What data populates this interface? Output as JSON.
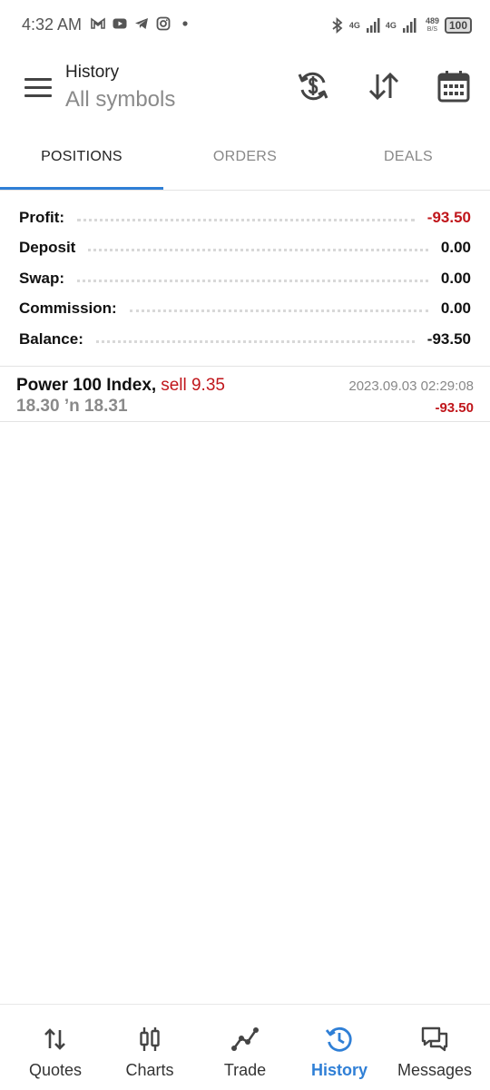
{
  "status_bar": {
    "time": "4:32 AM",
    "network_1": "4G",
    "network_2": "4G",
    "speed_value": "489",
    "speed_unit": "B/S",
    "battery": "100",
    "icons": [
      "gmail-icon",
      "youtube-icon",
      "telegram-icon",
      "instagram-icon",
      "dot-icon",
      "bluetooth-icon",
      "signal-icon"
    ]
  },
  "header": {
    "title": "History",
    "subtitle": "All symbols",
    "icons": [
      "menu-icon",
      "currency-refresh-icon",
      "sort-icon",
      "calendar-icon"
    ]
  },
  "tabs": [
    {
      "label": "POSITIONS",
      "active": true
    },
    {
      "label": "ORDERS",
      "active": false
    },
    {
      "label": "DEALS",
      "active": false
    }
  ],
  "summary": [
    {
      "label": "Profit:",
      "value": "-93.50"
    },
    {
      "label": "Deposit",
      "value": "0.00"
    },
    {
      "label": "Swap:",
      "value": "0.00"
    },
    {
      "label": "Commission:",
      "value": "0.00"
    },
    {
      "label": "Balance:",
      "value": "-93.50"
    }
  ],
  "positions": [
    {
      "symbol": "Power 100 Index,",
      "type": "sell 9.35",
      "prices": "18.30 ’n  18.31",
      "datetime": "2023.09.03 02:29:08",
      "profit": "-93.50"
    }
  ],
  "bottom_nav": [
    {
      "label": "Quotes",
      "icon": "quotes-icon",
      "active": false
    },
    {
      "label": "Charts",
      "icon": "charts-icon",
      "active": false
    },
    {
      "label": "Trade",
      "icon": "trade-icon",
      "active": false
    },
    {
      "label": "History",
      "icon": "history-icon",
      "active": true
    },
    {
      "label": "Messages",
      "icon": "messages-icon",
      "active": false
    }
  ],
  "colors": {
    "accent": "#2f7fd6",
    "negative": "#c0161b"
  }
}
